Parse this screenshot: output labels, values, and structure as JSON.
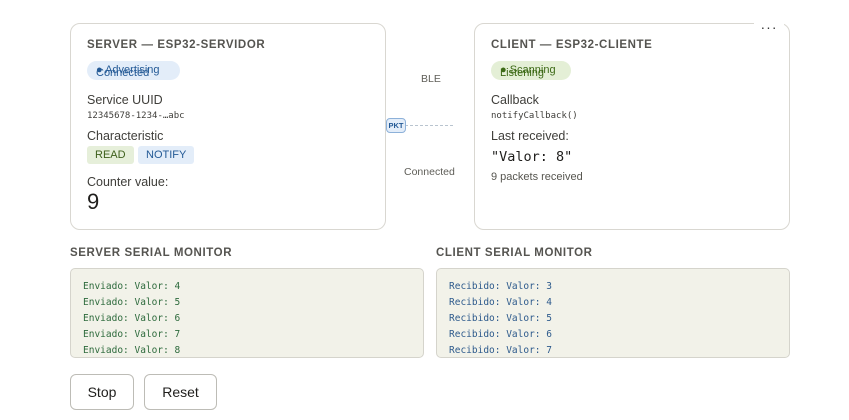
{
  "server": {
    "title": "SERVER — ESP32-SERVIDOR",
    "status_primary": "● Advertising",
    "status_overlay": "Connected",
    "service_uuid_label": "Service UUID",
    "service_uuid_value": "12345678-1234-…abc",
    "characteristic_label": "Characteristic",
    "tags": [
      "READ",
      "NOTIFY"
    ],
    "counter_label": "Counter value:",
    "counter_value": "9"
  },
  "client": {
    "title": "CLIENT — ESP32-CLIENTE",
    "status_primary": "● Scanning",
    "status_overlay": "Listening",
    "callback_label": "Callback",
    "callback_value": "notifyCallback()",
    "last_received_label": "Last received:",
    "last_received_value": "\"Valor: 8\"",
    "packets_text": "9 packets received",
    "menu_label": "···"
  },
  "link": {
    "top_label": "BLE",
    "bottom_label": "Connected",
    "packet_label": "PKT"
  },
  "monitors": {
    "server_title": "SERVER SERIAL MONITOR",
    "client_title": "CLIENT SERIAL MONITOR",
    "server_lines": [
      "Enviado: Valor: 4",
      "Enviado: Valor: 5",
      "Enviado: Valor: 6",
      "Enviado: Valor: 7",
      "Enviado: Valor: 8"
    ],
    "client_lines": [
      "Recibido: Valor: 3",
      "Recibido: Valor: 4",
      "Recibido: Valor: 5",
      "Recibido: Valor: 6",
      "Recibido: Valor: 7"
    ]
  },
  "controls": {
    "stop_label": "Stop",
    "reset_label": "Reset"
  },
  "colors": {
    "pill_blue_bg": "#e3edf9",
    "pill_green_bg": "#e4efd6",
    "monitor_bg": "#f2f2e9"
  }
}
